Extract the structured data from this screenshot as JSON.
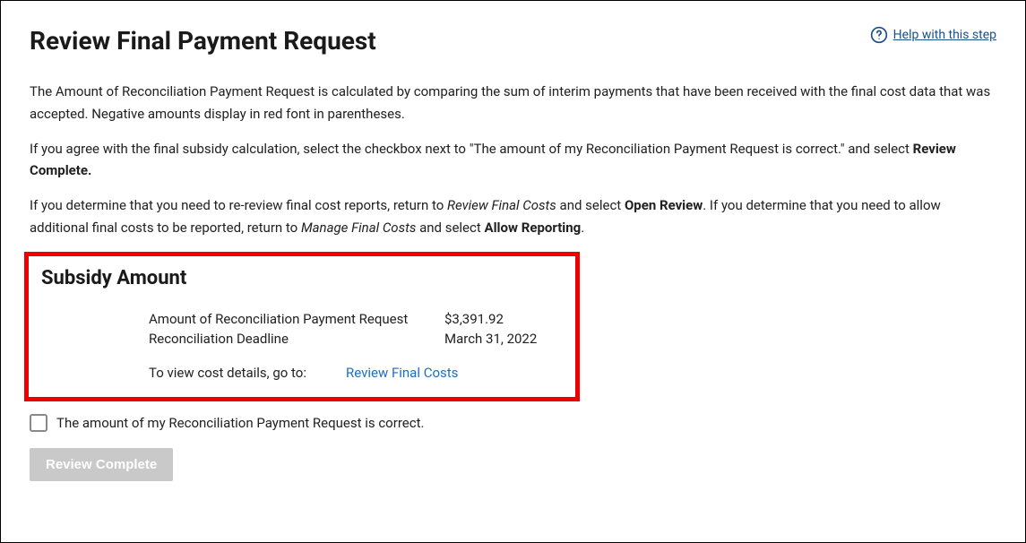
{
  "header": {
    "title": "Review Final Payment Request",
    "help_label": "Help with this step"
  },
  "paragraphs": {
    "p1": "The Amount of Reconciliation Payment Request is calculated by comparing the sum of interim payments that have been received with the final cost data that was accepted. Negative amounts display in red font in parentheses.",
    "p2_pre": "If you agree with the final subsidy calculation, select the checkbox next to \"The amount of my Reconciliation Payment Request is correct.\" and select ",
    "p2_bold": "Review Complete.",
    "p3_a": "If you determine that you need to re-review final cost reports, return to ",
    "p3_em1": "Review Final Costs",
    "p3_b": " and select ",
    "p3_bold1": "Open Review",
    "p3_c": ". If you determine that you need to allow additional final costs to be reported, return to ",
    "p3_em2": "Manage Final Costs",
    "p3_d": " and select ",
    "p3_bold2": "Allow Reporting",
    "p3_e": "."
  },
  "subsidy": {
    "title": "Subsidy Amount",
    "row1_label": "Amount of Reconciliation Payment Request",
    "row1_value": "$3,391.92",
    "row2_label": "Reconciliation Deadline",
    "row2_value": "March 31, 2022",
    "link_label": "To view cost details, go to:",
    "link_value": "Review Final Costs"
  },
  "confirm": {
    "checkbox_label": "The amount of my Reconciliation Payment Request is correct.",
    "button_label": "Review Complete"
  }
}
